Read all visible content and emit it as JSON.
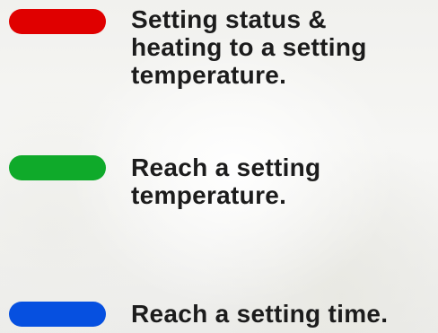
{
  "legend": {
    "items": [
      {
        "color": "#e00000",
        "label": "Setting status &\nheating to a setting\ntemperature."
      },
      {
        "color": "#0faa2a",
        "label": "Reach a setting\ntemperature."
      },
      {
        "color": "#0650e0",
        "label": "Reach a setting time."
      }
    ]
  }
}
